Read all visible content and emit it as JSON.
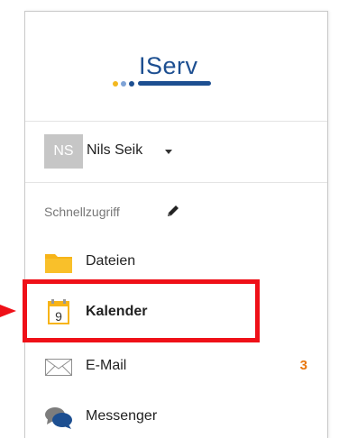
{
  "logo": {
    "text": "IServ",
    "colors": {
      "brand": "#1d4f91",
      "dot1": "#f3b81f",
      "dot2": "#7fa3d6",
      "dot3": "#1d4f91"
    }
  },
  "user": {
    "initials": "NS",
    "name": "Nils Seik"
  },
  "quick_access": {
    "label": "Schnellzugriff",
    "edit_icon": "pencil-icon"
  },
  "nav": {
    "items": [
      {
        "label": "Dateien",
        "icon": "folder-icon"
      },
      {
        "label": "Kalender",
        "icon": "calendar-icon",
        "icon_day": "9",
        "highlighted": true
      },
      {
        "label": "E-Mail",
        "icon": "envelope-icon",
        "badge": "3"
      },
      {
        "label": "Messenger",
        "icon": "chat-bubbles-icon"
      }
    ]
  },
  "colors": {
    "highlight": "#ef1018",
    "badge": "#e8770f",
    "folder": "#f7b418"
  }
}
